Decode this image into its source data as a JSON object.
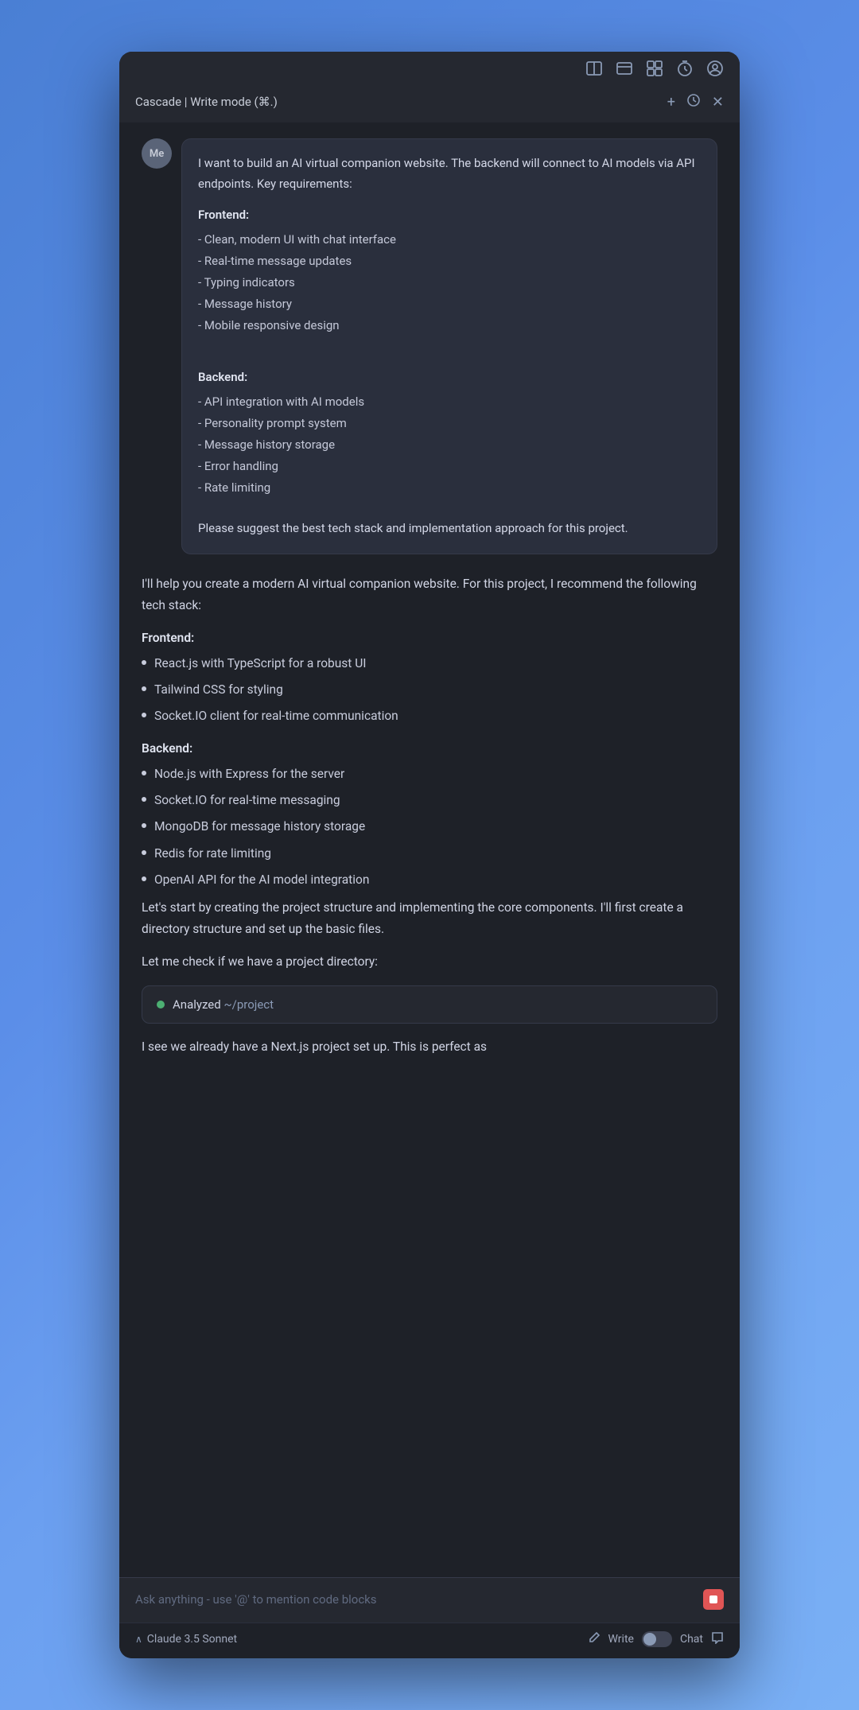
{
  "window": {
    "title": "Cascade | Write mode (⌘.)",
    "buttons": {
      "add": "+",
      "history": "⟳",
      "close": "✕"
    }
  },
  "toolbar": {
    "icons": [
      "split-view-icon",
      "window-icon",
      "grid-icon",
      "timer-icon",
      "profile-icon"
    ]
  },
  "user_message": {
    "avatar": "Me",
    "intro": "I want to build an AI virtual companion website. The backend will connect to AI models via API endpoints. Key requirements:",
    "frontend_header": "Frontend:",
    "frontend_items": [
      "- Clean, modern UI with chat interface",
      "- Real-time message updates",
      "- Typing indicators",
      "- Message history",
      "- Mobile responsive design"
    ],
    "backend_header": "Backend:",
    "backend_items": [
      "- API integration with AI models",
      "- Personality prompt system",
      "- Message history storage",
      "- Error handling",
      "- Rate limiting"
    ],
    "closing": "Please suggest the best tech stack and implementation approach for this project."
  },
  "ai_response": {
    "intro": "I'll help you create a modern AI virtual companion website. For this project, I recommend the following tech stack:",
    "frontend_title": "Frontend:",
    "frontend_items": [
      "React.js with TypeScript for a robust UI",
      "Tailwind CSS for styling",
      "Socket.IO client for real-time communication"
    ],
    "backend_title": "Backend:",
    "backend_items": [
      "Node.js with Express for the server",
      "Socket.IO for real-time messaging",
      "MongoDB for message history storage",
      "Redis for rate limiting",
      "OpenAI API for the AI model integration"
    ],
    "continuation": "Let's start by creating the project structure and implementing the core components. I'll first create a directory structure and set up the basic files.",
    "check_text": "Let me check if we have a project directory:",
    "analysis_status": "Analyzed",
    "analysis_path": "~/project",
    "final_text": "I see we already have a Next.js project set up. This is perfect as"
  },
  "input": {
    "placeholder": "Ask anything - use '@' to mention code blocks"
  },
  "bottom_bar": {
    "model": "Claude 3.5 Sonnet",
    "write_mode": "Write",
    "chat_mode": "Chat"
  }
}
